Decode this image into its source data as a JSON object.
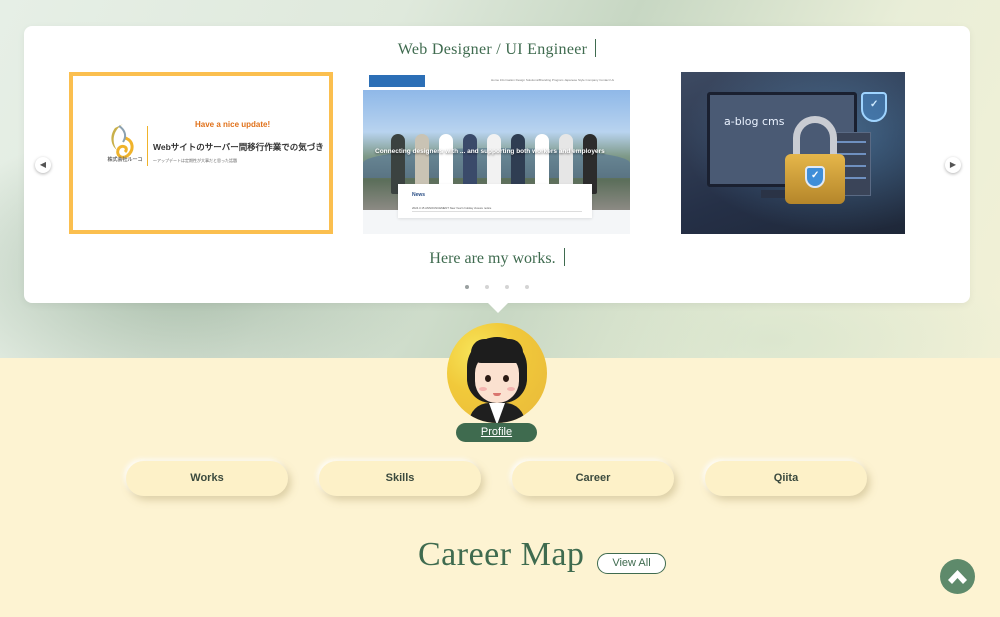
{
  "hero": {
    "headline": "Web Designer / UI Engineer",
    "subheadline": "Here are my works.",
    "prev_arrow": "◀",
    "next_arrow": "▶"
  },
  "slides": [
    {
      "eyebrow": "Have a nice update!",
      "title": "Webサイトのサーバー間移行作業での気づき",
      "subtitle": "～アップデートは定期性が大事だと思った話題",
      "logo_text": "株式会社ルーコ"
    },
    {
      "nav_links": "Home Information   Design Solutions/Branding Program   Japanese Style Company   Contact Us",
      "overlay_text": "Connecting designers with ... and supporting both workers and employers",
      "news_title": "News",
      "news_row": "2024.3.15   ANNOUNCEMENT   New Year's holiday closure notice"
    },
    {
      "monitor_text": "a-blog cms"
    }
  ],
  "profile": {
    "label": "Profile"
  },
  "nav": {
    "works": "Works",
    "skills": "Skills",
    "career": "Career",
    "qiita": "Qiita"
  },
  "career_section": {
    "title": "Career Map",
    "view_all": "View All"
  },
  "colors": {
    "brand_green": "#3f6b4f",
    "cream": "#fdf3d2",
    "accent_orange": "#e0711a"
  }
}
